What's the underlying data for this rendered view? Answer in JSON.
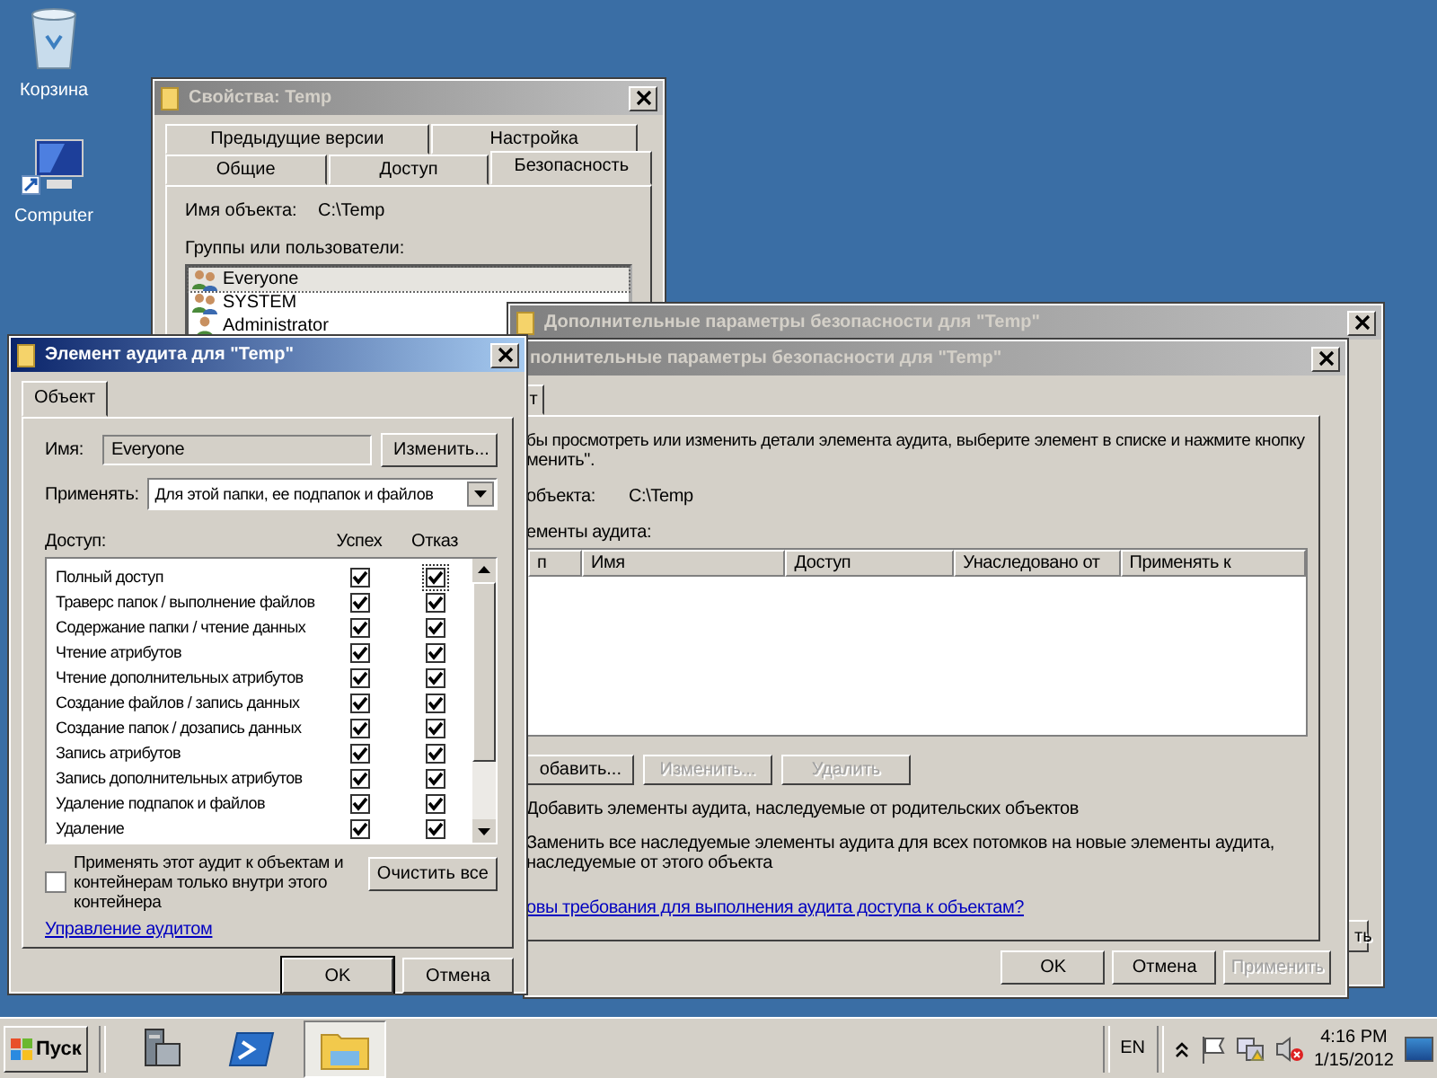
{
  "desktop_icons": [
    {
      "label": "Корзина",
      "kind": "recycle"
    },
    {
      "label": "Computer",
      "kind": "computer"
    }
  ],
  "properties_window": {
    "title": "Свойства: Temp",
    "tabs_back": [
      {
        "label": "Предыдущие версии",
        "selected": false
      },
      {
        "label": "Настройка",
        "selected": false
      }
    ],
    "tabs_front": [
      {
        "label": "Общие",
        "selected": false
      },
      {
        "label": "Доступ",
        "selected": false
      },
      {
        "label": "Безопасность",
        "selected": true
      }
    ],
    "object_label": "Имя объекта:",
    "object_value": "C:\\Temp",
    "groups_label": "Группы или пользователи:",
    "users": [
      {
        "name": "Everyone",
        "kind": "group",
        "selected": true
      },
      {
        "name": "SYSTEM",
        "kind": "group",
        "selected": false
      },
      {
        "name": "Administrator",
        "kind": "user",
        "selected": false
      }
    ]
  },
  "advanced_window_back": {
    "title": "Дополнительные параметры безопасности  для \"Temp\"",
    "apply_button": "ть"
  },
  "advanced_window": {
    "title": "полнительные параметры безопасности  для \"Temp\"",
    "tab": "т",
    "instruction_lines": [
      "бы просмотреть или изменить детали элемента аудита, выберите элемент в списке и нажмите кнопку",
      "менить\"."
    ],
    "object_label": "объекта:",
    "object_value": "C:\\Temp",
    "entries_label": "ементы аудита:",
    "columns": [
      "п",
      "Имя",
      "Доступ",
      "Унаследовано от",
      "Применять к"
    ],
    "actions": [
      {
        "label": "обавить...",
        "disabled": false
      },
      {
        "label": "Изменить...",
        "disabled": true
      },
      {
        "label": "Удалить",
        "disabled": true
      }
    ],
    "options": [
      "Добавить элементы аудита, наследуемые от родительских объектов",
      "Заменить все наследуемые элементы аудита для всех потомков на новые элементы аудита, наследуемые от этого объекта"
    ],
    "link": "овы требования для выполнения аудита доступа к объектам?",
    "buttons": [
      {
        "label": "OK",
        "disabled": false
      },
      {
        "label": "Отмена",
        "disabled": false
      },
      {
        "label": "Применить",
        "disabled": true
      }
    ]
  },
  "audit_dialog": {
    "title": "Элемент аудита для \"Temp\"",
    "tab": "Объект",
    "name_label": "Имя:",
    "name_value": "Everyone",
    "change_button": "Изменить...",
    "apply_label": "Применять:",
    "apply_value": "Для этой папки, ее подпапок и файлов",
    "access_label": "Доступ:",
    "success_label": "Успех",
    "failure_label": "Отказ",
    "permissions": [
      {
        "name": "Полный доступ",
        "success": true,
        "failure": true
      },
      {
        "name": "Траверс папок / выполнение файлов",
        "success": true,
        "failure": true
      },
      {
        "name": "Содержание папки / чтение данных",
        "success": true,
        "failure": true
      },
      {
        "name": "Чтение атрибутов",
        "success": true,
        "failure": true
      },
      {
        "name": "Чтение дополнительных атрибутов",
        "success": true,
        "failure": true
      },
      {
        "name": "Создание файлов / запись данных",
        "success": true,
        "failure": true
      },
      {
        "name": "Создание папок / дозапись данных",
        "success": true,
        "failure": true
      },
      {
        "name": "Запись атрибутов",
        "success": true,
        "failure": true
      },
      {
        "name": "Запись дополнительных атрибутов",
        "success": true,
        "failure": true
      },
      {
        "name": "Удаление подпапок и файлов",
        "success": true,
        "failure": true
      },
      {
        "name": "Удаление",
        "success": true,
        "failure": true
      }
    ],
    "inside_only": {
      "label": "Применять этот аудит к объектам и контейнерам только внутри этого контейнера",
      "checked": false
    },
    "clear_button": "Очистить все",
    "link": "Управление аудитом",
    "ok_button": "OK",
    "cancel_button": "Отмена"
  },
  "taskbar": {
    "start": "Пуск",
    "apps": [
      {
        "kind": "server",
        "selected": false
      },
      {
        "kind": "powershell",
        "selected": false
      },
      {
        "kind": "explorer",
        "selected": true
      }
    ],
    "language": "EN",
    "time": "4:16 PM",
    "date": "1/15/2012"
  }
}
